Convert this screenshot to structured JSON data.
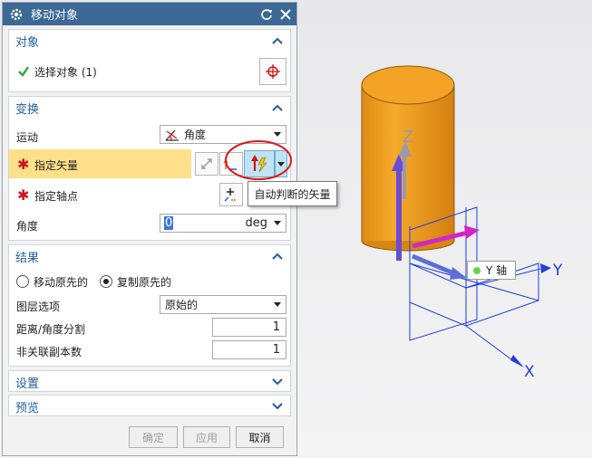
{
  "dialog": {
    "title": "移动对象",
    "sections": {
      "object": {
        "header": "对象",
        "select_label": "选择对象 (1)"
      },
      "transform": {
        "header": "变换",
        "motion_label": "运动",
        "motion_value": "角度",
        "vector_label": "指定矢量",
        "axis_point_label": "指定轴点",
        "angle_label": "角度",
        "angle_value": "0",
        "angle_unit": "deg"
      },
      "result": {
        "header": "结果",
        "radio_move": "移动原先的",
        "radio_copy": "复制原先的",
        "radio_selected": "copy",
        "layer_label": "图层选项",
        "layer_value": "原始的",
        "distance_label": "距离/角度分割",
        "distance_value": "1",
        "copies_label": "非关联副本数",
        "copies_value": "1"
      },
      "settings": {
        "header": "设置"
      },
      "preview": {
        "header": "预览"
      }
    },
    "buttons": {
      "ok": "确定",
      "apply": "应用",
      "cancel": "取消"
    }
  },
  "tooltip": "自动判断的矢量",
  "viewport": {
    "axis_z": "Z",
    "axis_y": "Y",
    "axis_x": "X",
    "y_axis_label": "Y 轴"
  },
  "colors": {
    "titlebar": "#3c6896",
    "section_header_text": "#1f5f9f",
    "highlight_row": "#ffe08a",
    "cylinder": "#f0a020",
    "required_star": "#d0141b",
    "annotation_circle": "#e0141b"
  }
}
